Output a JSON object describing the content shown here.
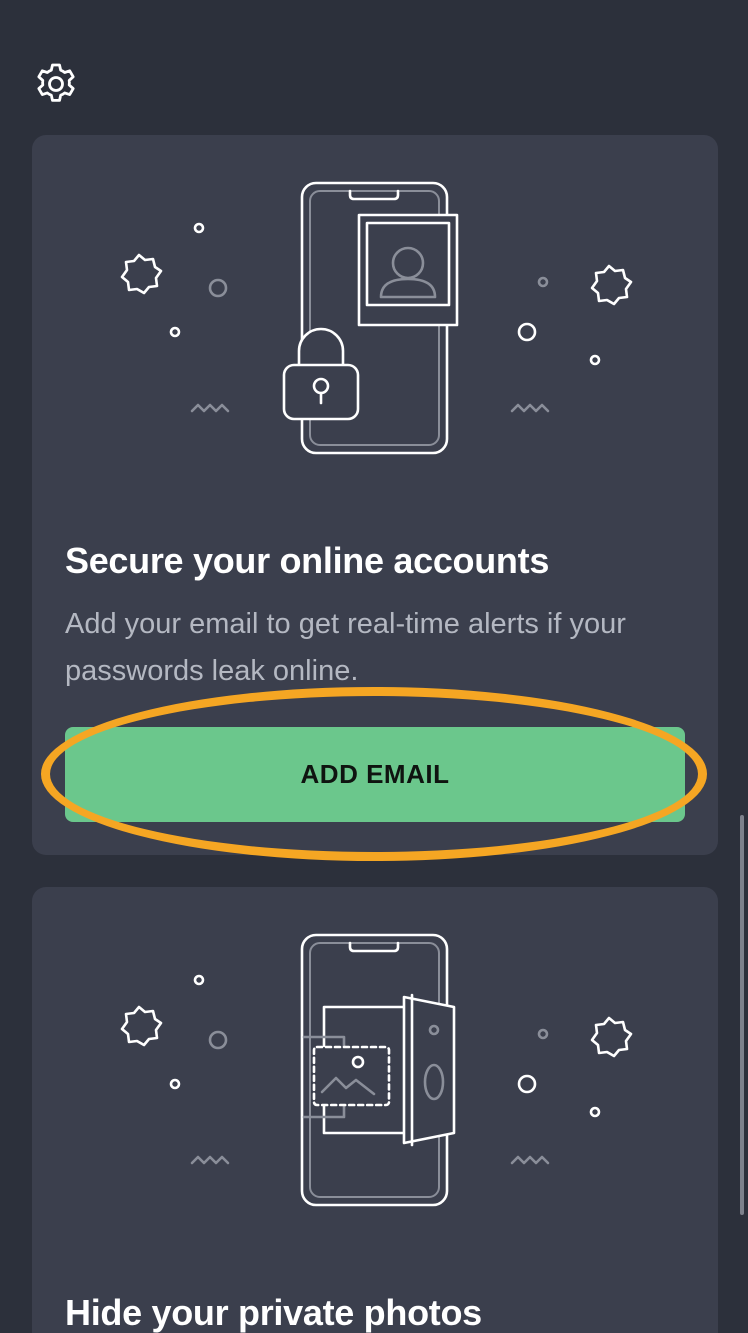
{
  "header": {
    "settings_icon": "gear-icon"
  },
  "cards": [
    {
      "illustration_icon": "phone-lock-profile-icon",
      "title": "Secure your online accounts",
      "description": "Add your email to get real-time alerts if your passwords leak online.",
      "button_label": "ADD EMAIL"
    },
    {
      "illustration_icon": "phone-vault-photo-icon",
      "title": "Hide your private photos"
    }
  ],
  "colors": {
    "background": "#2c303b",
    "card": "#3b3f4d",
    "accent_green": "#6bc78c",
    "highlight_orange": "#f5a623"
  }
}
